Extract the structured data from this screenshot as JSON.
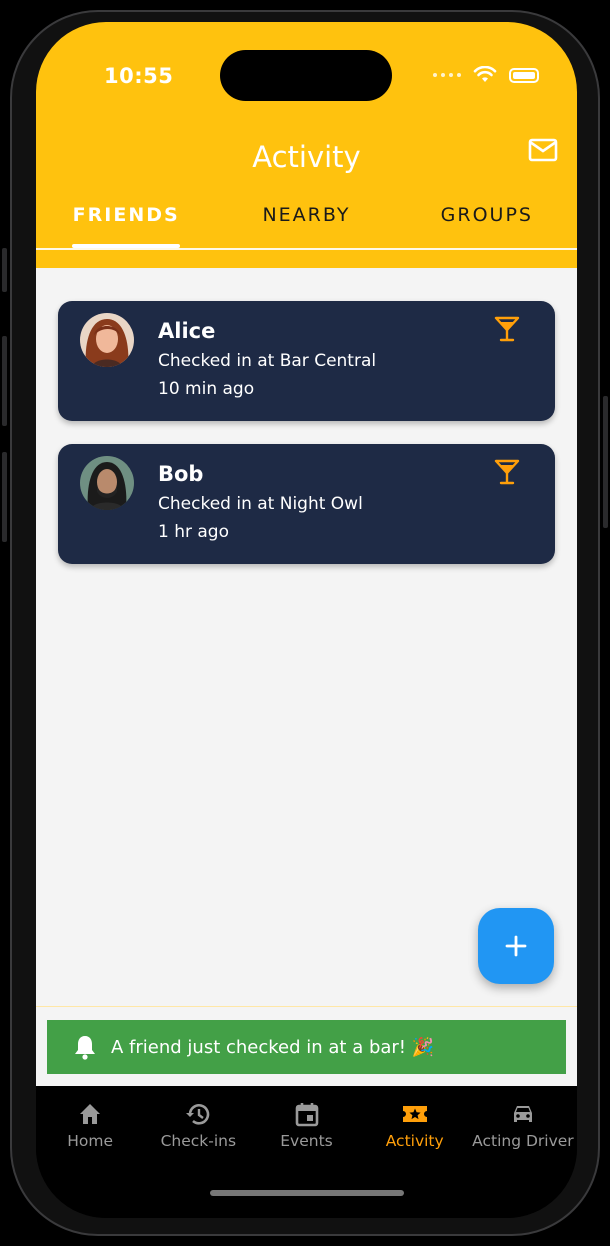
{
  "status_bar": {
    "time": "10:55"
  },
  "header": {
    "title": "Activity"
  },
  "tabs": [
    {
      "label": "FRIENDS",
      "active": true
    },
    {
      "label": "NEARBY",
      "active": false
    },
    {
      "label": "GROUPS",
      "active": false
    }
  ],
  "activity": [
    {
      "name": "Alice",
      "place": "Checked in at Bar Central",
      "time": "10 min ago",
      "icon": "cocktail-icon"
    },
    {
      "name": "Bob",
      "place": "Checked in at Night Owl",
      "time": "1 hr ago",
      "icon": "cocktail-icon"
    }
  ],
  "fab": {
    "icon": "plus-icon"
  },
  "notification": {
    "text": "A friend just checked in at a bar! 🎉",
    "icon": "bell-icon"
  },
  "bottom_nav": [
    {
      "label": "Home",
      "icon": "home-icon",
      "active": false
    },
    {
      "label": "Check-ins",
      "icon": "history-icon",
      "active": false
    },
    {
      "label": "Events",
      "icon": "calendar-icon",
      "active": false
    },
    {
      "label": "Activity",
      "icon": "ticket-star-icon",
      "active": true
    },
    {
      "label": "Acting Driver",
      "icon": "car-icon",
      "active": false
    }
  ],
  "colors": {
    "header": "#FFC20E",
    "card": "#1E2A45",
    "accent": "#FF9F0A",
    "fab": "#2196F3",
    "snackbar": "#43A047"
  }
}
